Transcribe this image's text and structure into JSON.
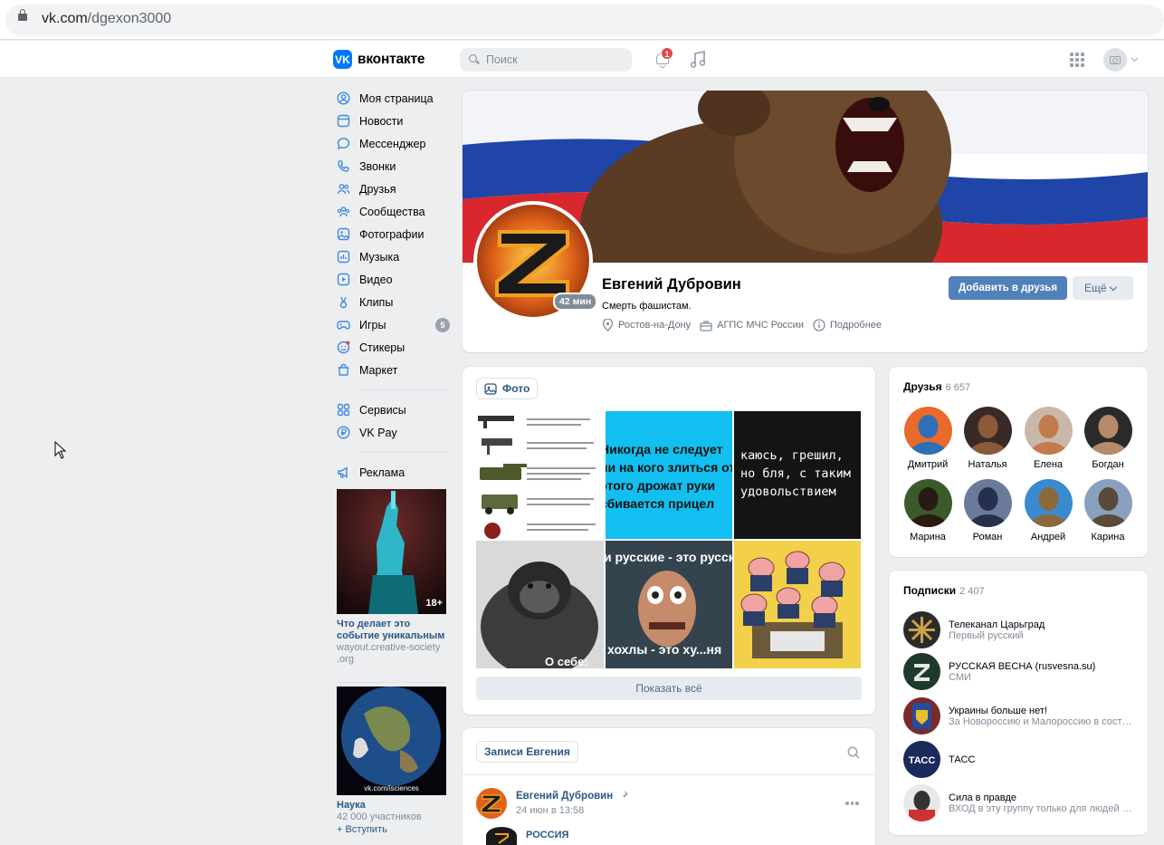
{
  "browser": {
    "url_host": "vk.com",
    "url_path": "/dgexon3000"
  },
  "header": {
    "logo_text": "вконтакте",
    "search_placeholder": "Поиск",
    "notifications_count": "1"
  },
  "nav": {
    "items": [
      {
        "label": "Моя страница",
        "icon": "user-circle-icon"
      },
      {
        "label": "Новости",
        "icon": "news-icon"
      },
      {
        "label": "Мессенджер",
        "icon": "message-icon"
      },
      {
        "label": "Звонки",
        "icon": "phone-icon"
      },
      {
        "label": "Друзья",
        "icon": "friends-icon"
      },
      {
        "label": "Сообщества",
        "icon": "community-icon"
      },
      {
        "label": "Фотографии",
        "icon": "photo-icon"
      },
      {
        "label": "Музыка",
        "icon": "music-icon"
      },
      {
        "label": "Видео",
        "icon": "video-icon"
      },
      {
        "label": "Клипы",
        "icon": "clips-icon"
      },
      {
        "label": "Игры",
        "icon": "gamepad-icon",
        "count": "5"
      },
      {
        "label": "Стикеры",
        "icon": "sticker-icon"
      },
      {
        "label": "Маркет",
        "icon": "market-icon"
      }
    ],
    "items2": [
      {
        "label": "Сервисы",
        "icon": "services-icon"
      },
      {
        "label": "VK Pay",
        "icon": "vkpay-icon"
      }
    ],
    "items3": [
      {
        "label": "Реклама",
        "icon": "ads-icon"
      }
    ]
  },
  "ads": [
    {
      "badge": "18+",
      "title": "Что делает это событие уникальным",
      "sub": "wayout.creative-society .org"
    },
    {
      "caption": "vk.com/isciences",
      "title": "Наука",
      "sub": "42 000 участников",
      "link": "+ Вступить"
    }
  ],
  "profile": {
    "name": "Евгений Дубровин",
    "status": "Смерть фашистам.",
    "online": "42 мин",
    "city": "Ростов-на-Дону",
    "work": "АГПС МЧС России",
    "more_info": "Подробнее",
    "add_friend": "Добавить в друзья",
    "more": "Ещё"
  },
  "photos": {
    "chip": "Фото",
    "show_all": "Показать всё",
    "tile2_text": "Никогда не следует ни на кого злиться от этого дрожат руки сбивается прицел",
    "tile3_text": "каюсь, грешил, но бля, с таким удовольствием",
    "tile4_text": "О себе:",
    "tile5_top": "и русские - это русские",
    "tile5_bottom": "хохлы - это ху...ня"
  },
  "friends": {
    "title": "Друзья",
    "count": "6 657",
    "list": [
      "Дмитрий",
      "Наталья",
      "Елена",
      "Богдан",
      "Марина",
      "Роман",
      "Андрей",
      "Карина"
    ]
  },
  "subs": {
    "title": "Подписки",
    "count": "2 407",
    "list": [
      {
        "name": "Телеканал Царьград",
        "desc": "Первый русский"
      },
      {
        "name": "РУССКАЯ ВЕСНА (rusvesna.su)",
        "desc": "СМИ"
      },
      {
        "name": "Украины больше нет!",
        "desc": "За Новороссию и Малороссию в сост…"
      },
      {
        "name": "ТАСС",
        "desc": ""
      },
      {
        "name": "Сила в правде",
        "desc": "ВХОД в эту группу только для людей с…"
      }
    ],
    "tass_logo": "ТАСС"
  },
  "wall": {
    "tab": "Записи Евгения",
    "post_author": "Евгений Дубровин",
    "post_date": "24 июн в 13:58",
    "repost_author": "РОССИЯ"
  },
  "colors": {
    "accent": "#5181b8",
    "link": "#2a5885",
    "bg": "#edeef0",
    "vk_blue": "#0077ff"
  }
}
